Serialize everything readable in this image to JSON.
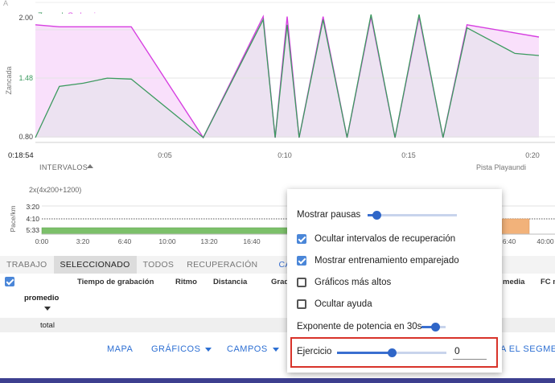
{
  "top_chart": {
    "legend": {
      "stride": "Zancada",
      "cadence": "Cadencia"
    },
    "y_axis_label": "Zancada",
    "y_ticks": [
      "2.00",
      "1.48",
      "0.80"
    ],
    "elapsed": "0:18:54",
    "x_ticks": [
      "0:05",
      "0:10",
      "0:15",
      "0:20"
    ],
    "intervals_label": "INTERVALOS",
    "track_label": "Pista Playaundi",
    "colors": {
      "stride": "#3c9a5f",
      "cadence": "#d63fe0",
      "stride_fill": "#efe3f3",
      "cadence_fill": "#f9e0fb"
    }
  },
  "chart_data": [
    {
      "type": "line",
      "title": "",
      "xlabel": "",
      "ylabel": "Zancada",
      "ylim": [
        0.8,
        2.0
      ],
      "x_ticks": [
        "0:05",
        "0:10",
        "0:15",
        "0:20"
      ],
      "series": [
        {
          "name": "Zancada",
          "x": [
            0,
            1,
            2,
            3,
            4,
            7,
            9.5,
            10,
            10.5,
            11,
            12,
            13,
            14,
            15,
            16,
            17,
            18,
            20,
            21
          ],
          "y": [
            0.8,
            1.3,
            1.33,
            1.38,
            1.37,
            0.8,
            1.95,
            0.8,
            1.9,
            0.8,
            1.95,
            0.8,
            2.0,
            0.8,
            2.0,
            0.8,
            1.87,
            1.62,
            1.6
          ]
        },
        {
          "name": "Cadencia",
          "x": [
            0,
            1,
            2,
            3,
            4,
            7,
            9.5,
            10,
            10.5,
            11,
            12,
            13,
            14,
            15,
            16,
            17,
            18,
            20,
            21
          ],
          "y": [
            1.9,
            1.88,
            1.88,
            1.88,
            1.88,
            0.8,
            1.98,
            0.8,
            1.98,
            0.8,
            1.98,
            0.8,
            1.98,
            0.8,
            1.98,
            0.8,
            1.9,
            1.82,
            1.78
          ]
        }
      ]
    },
    {
      "type": "bar",
      "title": "2x(4x200+1200)",
      "ylabel": "Pace/km",
      "y_ticks": [
        "3:20",
        "4:10",
        "5:33"
      ],
      "x_ticks": [
        "0:00",
        "3:20",
        "6:40",
        "10:00",
        "13:20",
        "16:40",
        "6:40",
        "40:00"
      ]
    }
  ],
  "pace_chart": {
    "title": "2x(4x200+1200)",
    "y_axis_label": "Pace/km",
    "y_ticks": [
      "3:20",
      "4:10",
      "5:33"
    ],
    "x_ticks": [
      "0:00",
      "3:20",
      "6:40",
      "10:00",
      "13:20",
      "16:40",
      "6:40",
      "40:00"
    ],
    "colors": {
      "work": "#7cc06a",
      "recovery": "#f2b27a"
    }
  },
  "tabs": {
    "items": [
      "TRABAJO",
      "SELECCIONADO",
      "TODOS",
      "RECUPERACIÓN"
    ],
    "active": "SELECCIONADO",
    "fields": "CAMPOS"
  },
  "table": {
    "columns": [
      "Tiempo de grabación",
      "Ritmo",
      "Distancia",
      "Grad",
      "media",
      "FC m"
    ],
    "rows": {
      "average": "promedio",
      "total": "total"
    }
  },
  "bottom_bar": {
    "map": "MAPA",
    "charts": "GRÁFICOS",
    "fields": "CAMPOS",
    "segment": "A EL SEGMEN"
  },
  "menu": {
    "show_pauses": "Mostrar pausas",
    "hide_recovery": "Ocultar intervalos de recuperación",
    "show_matched": "Mostrar entrenamiento emparejado",
    "taller_charts": "Gráficos más altos",
    "hide_help": "Ocultar ayuda",
    "power_exponent": "Exponente de potencia en 30s",
    "exercise": "Ejercicio",
    "exercise_value": "0",
    "checkbox_states": {
      "hide_recovery": true,
      "show_matched": true,
      "taller_charts": false,
      "hide_help": false
    },
    "slider_levels": {
      "show_pauses": 0.1,
      "power_exponent": 0.55,
      "exercise": 0.5
    }
  }
}
